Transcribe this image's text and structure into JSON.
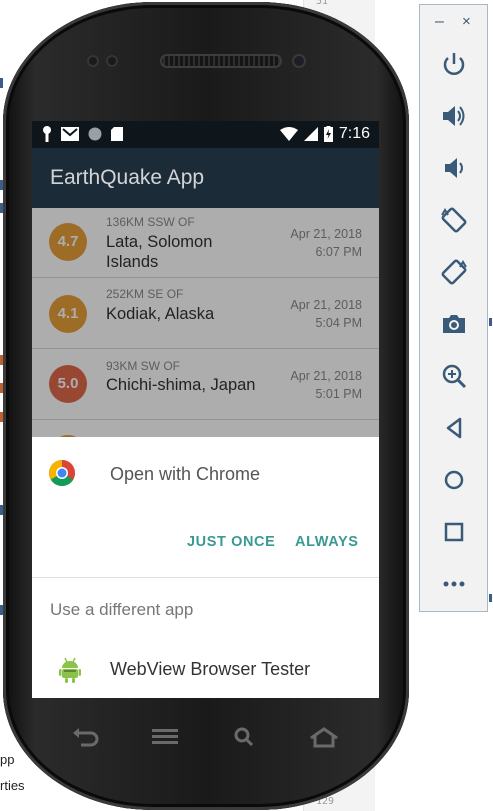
{
  "ide": {
    "line_top": "51",
    "line_bottom": "129",
    "left_fragments": [
      "pp",
      "rties"
    ]
  },
  "app": {
    "status_time": "7:16",
    "title": "EarthQuake App",
    "quakes": [
      {
        "magnitude": "4.7",
        "color": "#e8a03a",
        "offset": "136KM SSW OF",
        "place": "Lata, Solomon Islands",
        "date": "Apr 21, 2018",
        "time": "6:07 PM"
      },
      {
        "magnitude": "4.1",
        "color": "#e8a03a",
        "offset": "252KM SE OF",
        "place": "Kodiak, Alaska",
        "date": "Apr 21, 2018",
        "time": "5:04 PM"
      },
      {
        "magnitude": "5.0",
        "color": "#e06a4a",
        "offset": "93KM SW OF",
        "place": "Chichi-shima, Japan",
        "date": "Apr 21, 2018",
        "time": "5:01 PM"
      }
    ]
  },
  "chooser": {
    "open_with": "Open with Chrome",
    "just_once": "JUST ONCE",
    "always": "ALWAYS",
    "different_app": "Use a different app",
    "webview": "WebView Browser Tester"
  },
  "toolbar": {
    "minimize": "–",
    "close": "×",
    "buttons": [
      "power-icon",
      "volume-up-icon",
      "volume-down-icon",
      "rotate-left-icon",
      "rotate-right-icon",
      "camera-icon",
      "zoom-icon",
      "back-icon",
      "home-icon",
      "overview-icon",
      "more-icon"
    ]
  },
  "colors": {
    "accent": "#3a9a93",
    "appbar": "#1c2b38",
    "statusbar": "#0e151b",
    "toolbar_icon": "#3a5a7a"
  }
}
